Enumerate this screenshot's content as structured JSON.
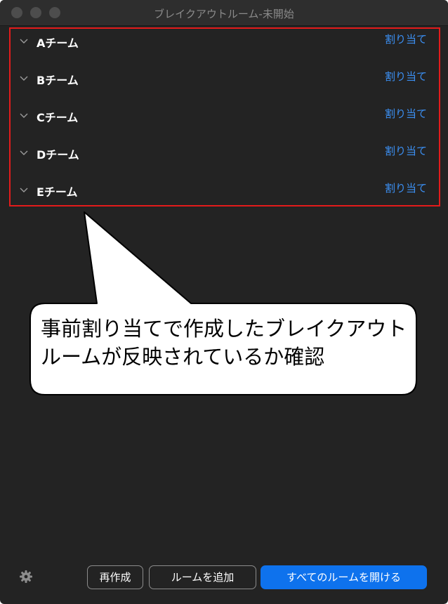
{
  "window": {
    "title": "ブレイクアウトルーム-未開始"
  },
  "rooms": [
    {
      "name": "Aチーム",
      "assign_label": "割り当て"
    },
    {
      "name": "Bチーム",
      "assign_label": "割り当て"
    },
    {
      "name": "Cチーム",
      "assign_label": "割り当て"
    },
    {
      "name": "Dチーム",
      "assign_label": "割り当て"
    },
    {
      "name": "Eチーム",
      "assign_label": "割り当て"
    }
  ],
  "annotation": {
    "text": "事前割り当てで作成したブレイクアウトルームが反映されているか確認",
    "highlight_color": "#e31b1b"
  },
  "footer": {
    "recreate_label": "再作成",
    "add_room_label": "ルームを追加",
    "open_all_label": "すべてのルームを開ける"
  },
  "colors": {
    "background": "#232323",
    "link": "#3b8ff2",
    "primary_button": "#0e72ed"
  },
  "icons": {
    "settings": "gear-icon",
    "expand": "chevron-down-icon"
  }
}
